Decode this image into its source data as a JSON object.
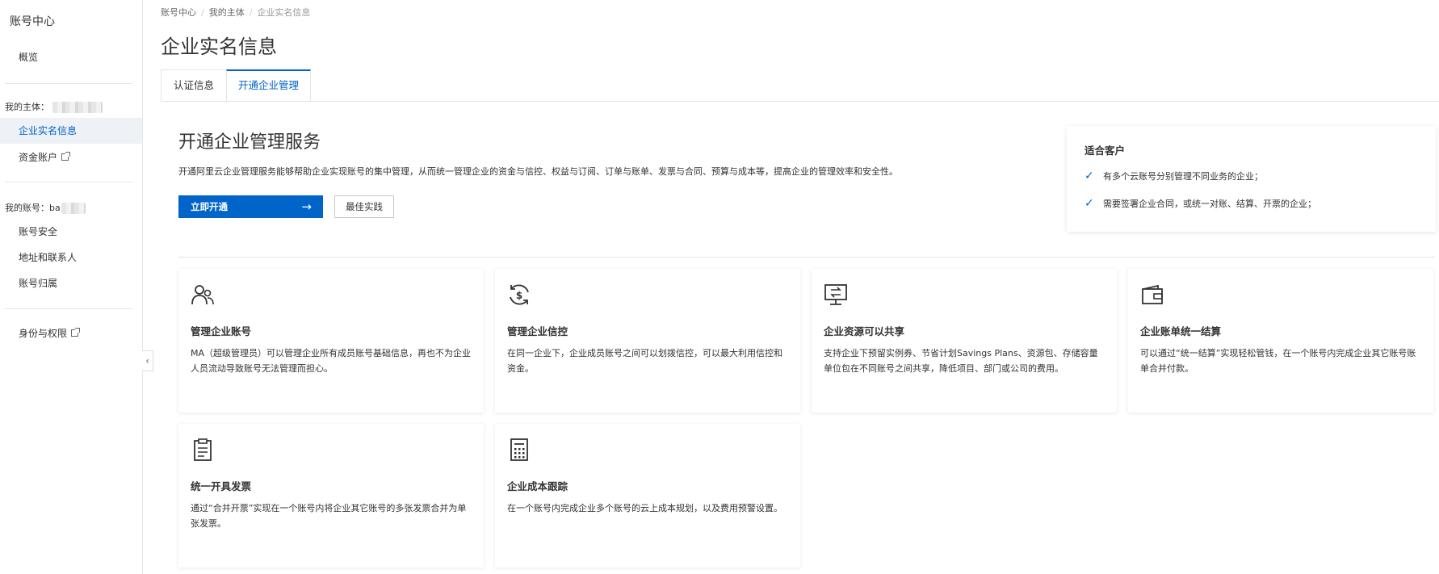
{
  "sidebar": {
    "title": "账号中心",
    "overview": "概览",
    "my_entity_label": "我的主体：",
    "entity_items": [
      {
        "label": "企业实名信息"
      },
      {
        "label": "资金账户"
      }
    ],
    "my_account_label": "我的账号：",
    "my_account_name": "ba",
    "account_items": [
      {
        "label": "账号安全"
      },
      {
        "label": "地址和联系人"
      },
      {
        "label": "账号归属"
      }
    ],
    "identity": "身份与权限",
    "collapse": "‹"
  },
  "breadcrumb": [
    "账号中心",
    "我的主体",
    "企业实名信息"
  ],
  "page_title": "企业实名信息",
  "tabs": [
    {
      "label": "认证信息",
      "active": false
    },
    {
      "label": "开通企业管理",
      "active": true
    }
  ],
  "service": {
    "title": "开通企业管理服务",
    "description": "开通阿里云企业管理服务能够帮助企业实现账号的集中管理，从而统一管理企业的资金与信控、权益与订阅、订单与账单、发票与合同、预算与成本等，提高企业的管理效率和安全性。",
    "primary_button": "立即开通",
    "primary_arrow": "→",
    "secondary_button": "最佳实践"
  },
  "fit_customers": {
    "title": "适合客户",
    "items": [
      "有多个云账号分别管理不同业务的企业；",
      "需要签署企业合同，或统一对账、结算、开票的企业；"
    ]
  },
  "features": [
    {
      "icon": "users-icon",
      "title": "管理企业账号",
      "desc": "MA（超级管理员）可以管理企业所有成员账号基础信息，再也不为企业人员流动导致账号无法管理而担心。"
    },
    {
      "icon": "dollar-cycle-icon",
      "title": "管理企业信控",
      "desc": "在同一企业下，企业成员账号之间可以划拨信控，可以最大利用信控和资金。"
    },
    {
      "icon": "monitor-share-icon",
      "title": "企业资源可以共享",
      "desc": "支持企业下预留实例券、节省计划Savings Plans、资源包、存储容量单位包在不同账号之间共享，降低项目、部门或公司的费用。"
    },
    {
      "icon": "wallet-icon",
      "title": "企业账单统一结算",
      "desc": "可以通过“统一结算”实现轻松管钱，在一个账号内完成企业其它账号账单合并付款。"
    },
    {
      "icon": "clipboard-icon",
      "title": "统一开具发票",
      "desc": "通过“合并开票”实现在一个账号内将企业其它账号的多张发票合并为单张发票。"
    },
    {
      "icon": "calculator-icon",
      "title": "企业成本跟踪",
      "desc": "在一个账号内完成企业多个账号的云上成本规划，以及费用预警设置。"
    }
  ],
  "colors": {
    "primary": "#0064c8",
    "active_bg": "#eef1f5",
    "border": "#e5e5e5"
  }
}
